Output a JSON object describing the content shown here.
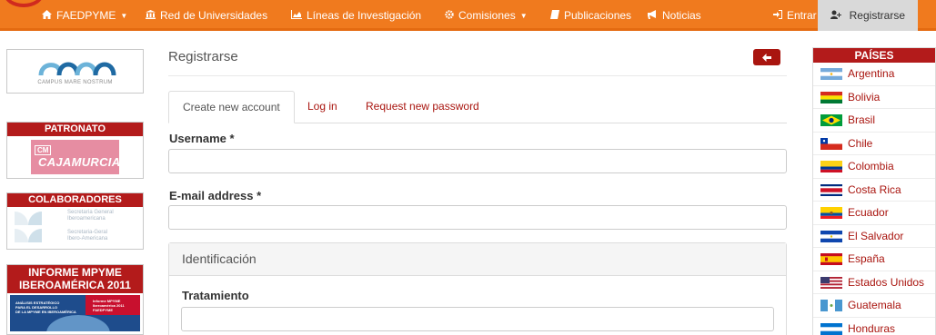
{
  "nav": {
    "items": [
      {
        "label": "FAEDPYME",
        "icon": "home-icon",
        "caret": true
      },
      {
        "label": "Red de Universidades",
        "icon": "institution-icon",
        "caret": false
      },
      {
        "label": "Líneas de Investigación",
        "icon": "area-chart-icon",
        "caret": false
      },
      {
        "label": "Comisiones",
        "icon": "cog-icon",
        "caret": true
      },
      {
        "label": "Publicaciones",
        "icon": "book-icon",
        "caret": false
      },
      {
        "label": "Noticias",
        "icon": "bullhorn-icon",
        "caret": false
      }
    ],
    "login": "Entrar",
    "register": "Registrarse"
  },
  "left": {
    "cmn_caption": "CAMPUS MARE NOSTRUM",
    "patronato_title": "PATRONATO",
    "cajamurcia": {
      "cm": "CM",
      "name": "CAJAMURCIA"
    },
    "colaboradores_title": "COLABORADORES",
    "colab_1": [
      "Secretaría General",
      "Iberoamericana"
    ],
    "colab_2": [
      "Secretaria-Geral",
      "Ibero-Americana"
    ],
    "informe_title": [
      "INFORME MPYME",
      "IBEROAMÉRICA 2011"
    ],
    "informe_cover_left": [
      "ANÁLISIS ESTRATÉGICO",
      "PARA EL DESARROLLO",
      "DE LA MPYME EN IBEROAMÉRICA"
    ],
    "informe_cover_right": [
      "Informe MPYME",
      "Iberoamérica 2011",
      "FAEDPYME"
    ]
  },
  "main": {
    "title": "Registrarse",
    "tabs": [
      "Create new account",
      "Log in",
      "Request new password"
    ],
    "username_label": "Username",
    "email_label": "E-mail address",
    "required_mark": "*",
    "username_value": "",
    "email_value": "",
    "panel_title": "Identificación",
    "tratamiento_label": "Tratamiento",
    "tratamiento_value": ""
  },
  "right": {
    "title": "PAÍSES",
    "countries": [
      "Argentina",
      "Bolivia",
      "Brasil",
      "Chile",
      "Colombia",
      "Costa Rica",
      "Ecuador",
      "El Salvador",
      "España",
      "Estados Unidos",
      "Guatemala",
      "Honduras"
    ]
  },
  "colors": {
    "nav_orange": "#f07a1e",
    "accent_red": "#b31b1b",
    "link_red": "#a9150f"
  }
}
